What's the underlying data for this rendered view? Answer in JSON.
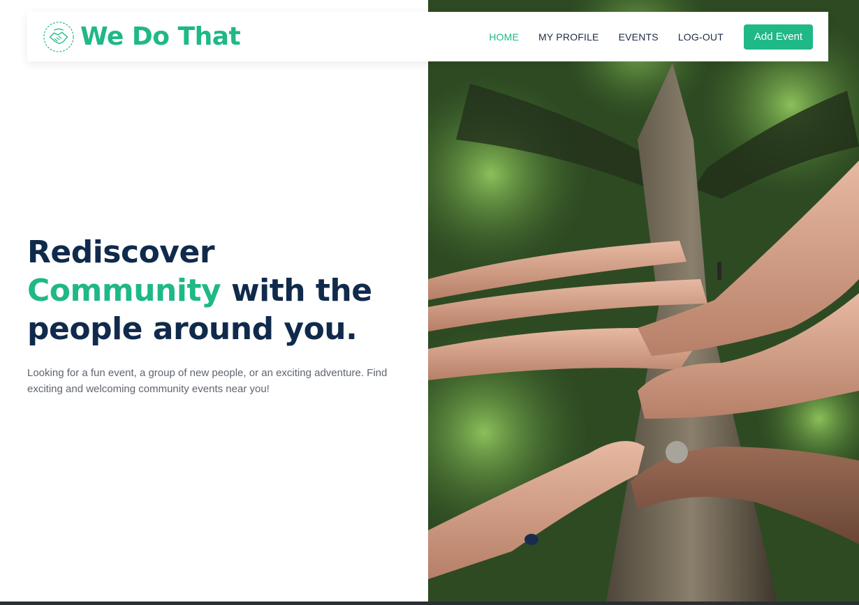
{
  "brand": {
    "name": "We Do That",
    "accent_color": "#1fb887",
    "logo_icon": "handshake-icon"
  },
  "nav": {
    "items": [
      {
        "label": "HOME",
        "active": true
      },
      {
        "label": "MY PROFILE",
        "active": false
      },
      {
        "label": "EVENTS",
        "active": false
      },
      {
        "label": "LOG-OUT",
        "active": false
      }
    ],
    "add_event_label": "Add Event"
  },
  "hero": {
    "headline_part1": "Rediscover ",
    "headline_accent": "Community",
    "headline_part2": " with the people around you.",
    "subtext": "Looking for a fun event, a group of new people, or an exciting adventure. Find exciting and welcoming community events near you!",
    "image_subject": "hands-on-tree-trunk-photo"
  },
  "colors": {
    "headline": "#102a4c",
    "accent": "#1fb887",
    "body_text": "#5e6470"
  }
}
